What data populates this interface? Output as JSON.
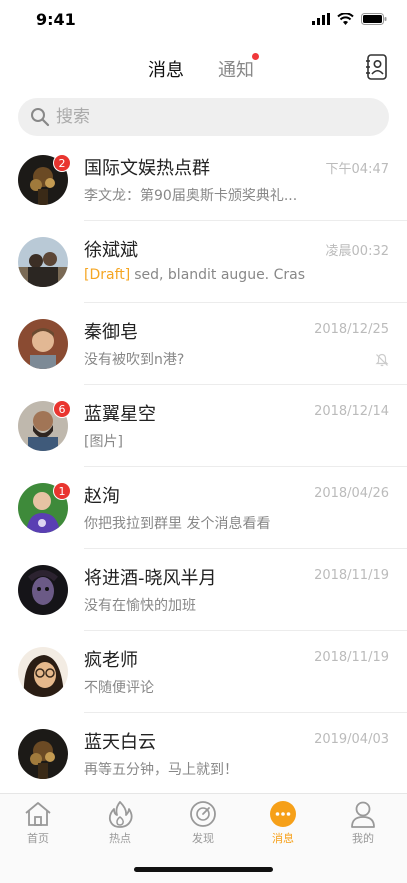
{
  "status": {
    "time": "9:41"
  },
  "header": {
    "tab_messages": "消息",
    "tab_notifications": "通知",
    "accent": "#f6a019"
  },
  "search": {
    "placeholder": "搜索"
  },
  "conversations": [
    {
      "name": "国际文娱热点群",
      "time": "下午04:47",
      "preview": "李文龙：第90届奥斯卡颁奖典礼...",
      "badge": "2",
      "draft": "",
      "avatar": "dark-crowd"
    },
    {
      "name": "徐斌斌",
      "time": "凌晨00:32",
      "preview": "sed, blandit augue. Cras",
      "badge": "",
      "draft": "[Draft]",
      "avatar": "beach-people"
    },
    {
      "name": "秦御皂",
      "time": "2018/12/25",
      "preview": "没有被吹到n港?",
      "badge": "",
      "draft": "",
      "avatar": "man-brick"
    },
    {
      "name": "蓝翼星空",
      "time": "2018/12/14",
      "preview": "[图片]",
      "badge": "6",
      "draft": "",
      "avatar": "bearded-man"
    },
    {
      "name": "赵洵",
      "time": "2018/04/26",
      "preview": "你把我拉到群里 发个消息看看",
      "badge": "1",
      "draft": "",
      "avatar": "purple-shirt"
    },
    {
      "name": "将进酒-晓风半月",
      "time": "2018/11/19",
      "preview": "没有在愉快的加班",
      "badge": "",
      "draft": "",
      "avatar": "dark-face"
    },
    {
      "name": "疯老师",
      "time": "2018/11/19",
      "preview": "不随便评论",
      "badge": "",
      "draft": "",
      "avatar": "woman-glasses"
    },
    {
      "name": "蓝天白云",
      "time": "2019/04/03",
      "preview": "再等五分钟，马上就到！",
      "badge": "",
      "draft": "",
      "avatar": "dark-crowd"
    }
  ],
  "tabbar": {
    "home": "首页",
    "hot": "热点",
    "discover": "发现",
    "messages": "消息",
    "me": "我的"
  }
}
